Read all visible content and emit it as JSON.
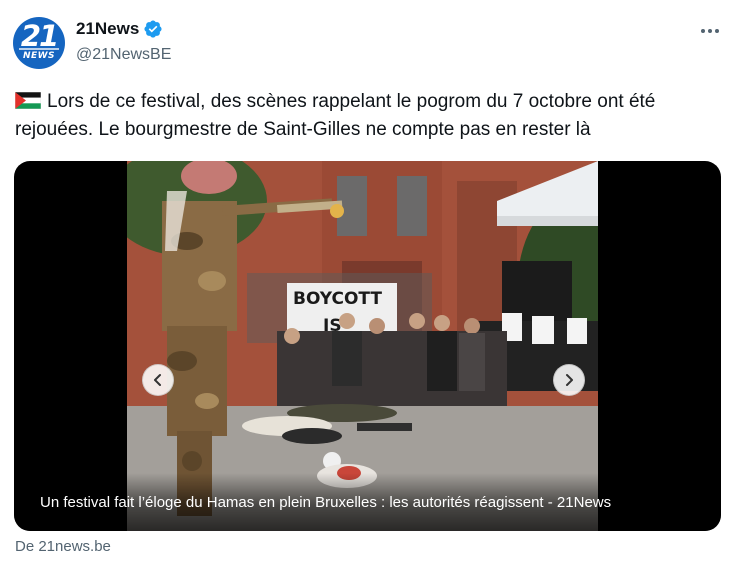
{
  "author": {
    "display_name": "21News",
    "handle": "@21NewsBE",
    "avatar_text": "21",
    "avatar_wordmark": "NEWS"
  },
  "tweet": {
    "flag": "palestine-flag",
    "text": "Lors de ce festival, des scènes rappelant le pogrom du 7 octobre ont été rejouées. Le bourgmestre de Saint-Gilles ne compte pas en rester là"
  },
  "card": {
    "caption": "Un festival fait l’éloge du Hamas en plein Bruxelles : les autorités réagissent - 21News",
    "sign_text": "BOYCOTT",
    "sign_text_2": "IS",
    "prev_icon": "chevron-left-icon",
    "next_icon": "chevron-right-icon"
  },
  "source": "De 21news.be",
  "colors": {
    "verified": "#1d9bf0",
    "avatar": "#1565c0",
    "secondary_text": "#536471"
  }
}
